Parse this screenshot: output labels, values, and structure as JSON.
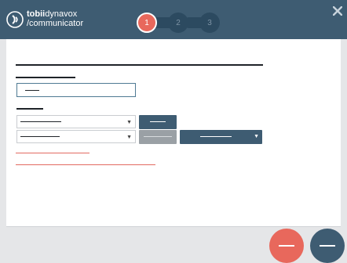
{
  "app": {
    "brand_bold": "tobii",
    "brand_rest": "dynavox",
    "brand_line2": "/communicator"
  },
  "steps": [
    {
      "label": "1",
      "state": "active"
    },
    {
      "label": "2",
      "state": "inactive"
    },
    {
      "label": "3",
      "state": "inactive"
    }
  ],
  "colors": {
    "header": "#3e5c72",
    "step_active": "#e8685c",
    "step_inactive": "#2c4a60",
    "primary_button": "#3e5c72",
    "disabled_button": "#9aa0a5",
    "error": "#e26a61",
    "back_button": "#e8685c",
    "next_button": "#3e5c72"
  },
  "icons": {
    "logo": "tobii-logo-icon",
    "close": "close-icon",
    "caret": "chevron-down-icon"
  }
}
